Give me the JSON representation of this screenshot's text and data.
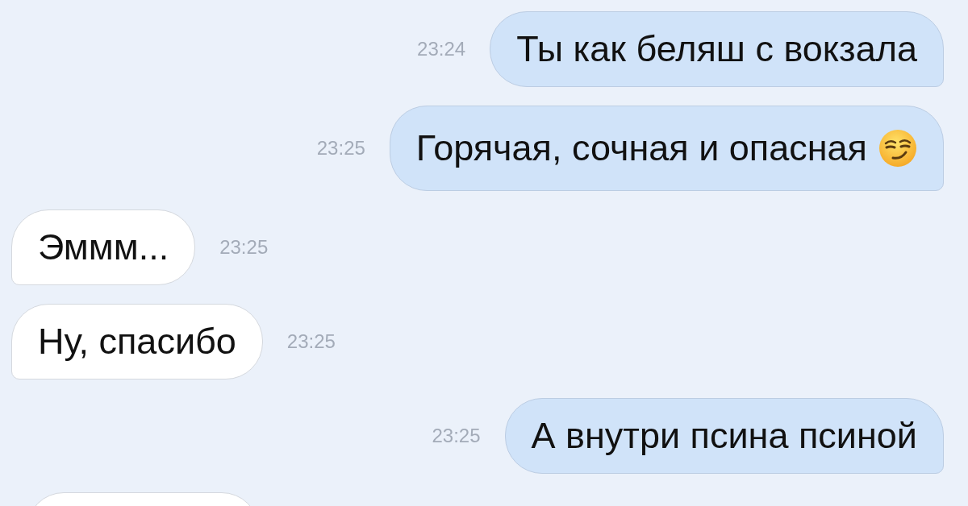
{
  "messages": [
    {
      "outgoing": true,
      "time": "23:24",
      "text": "Ты как беляш с вокзала"
    },
    {
      "outgoing": true,
      "time": "23:25",
      "text": "Горячая, сочная и опасная",
      "emoji": true
    },
    {
      "outgoing": false,
      "time": "23:25",
      "text": "Эммм..."
    },
    {
      "outgoing": false,
      "time": "23:25",
      "text": "Ну, спасибо"
    },
    {
      "outgoing": true,
      "time": "23:25",
      "text": "А внутри псина псиной"
    },
    {
      "outgoing": false
    }
  ]
}
